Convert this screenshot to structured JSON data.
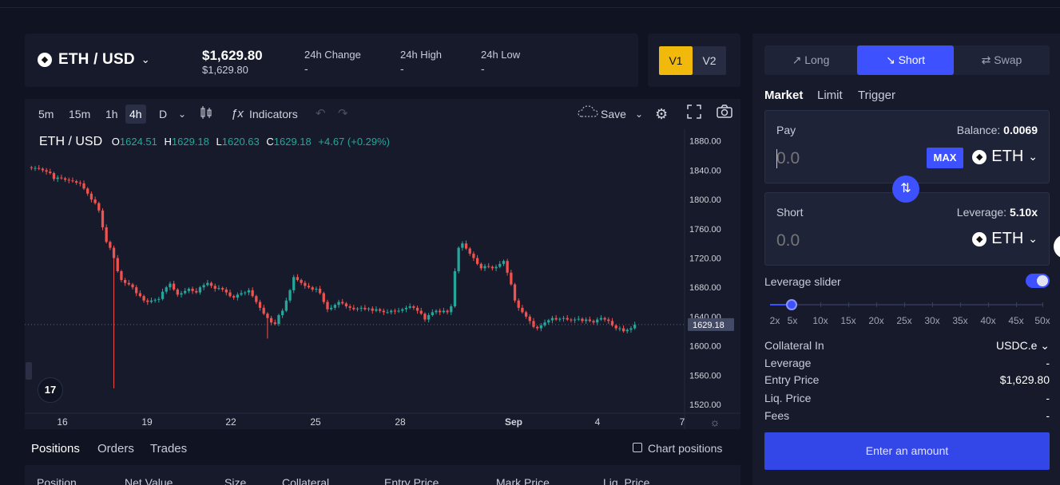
{
  "header": {
    "pair": "ETH / USD",
    "token_symbol": "◆",
    "price": "$1,629.80",
    "price_sub": "$1,629.80",
    "stats": [
      {
        "label": "24h Change",
        "value": "-"
      },
      {
        "label": "24h High",
        "value": "-"
      },
      {
        "label": "24h Low",
        "value": "-"
      }
    ],
    "versions": [
      "V1",
      "V2"
    ]
  },
  "toolbar": {
    "intervals": [
      "5m",
      "15m",
      "1h",
      "4h",
      "D"
    ],
    "active_interval": "4h",
    "indicators_label": "Indicators",
    "save_label": "Save"
  },
  "legend": {
    "symbol": "ETH / USD",
    "o_label": "O",
    "o": "1624.51",
    "h_label": "H",
    "h": "1629.18",
    "l_label": "L",
    "l": "1620.63",
    "c_label": "C",
    "c": "1629.18",
    "change": "+4.67 (+0.29%)"
  },
  "chart_data": {
    "type": "candlestick",
    "x_tick_labels": [
      "16",
      "19",
      "22",
      "25",
      "28",
      "Sep",
      "4",
      "7"
    ],
    "y_tick_labels": [
      "1880.00",
      "1840.00",
      "1800.00",
      "1760.00",
      "1720.00",
      "1680.00",
      "1640.00",
      "1600.00",
      "1560.00",
      "1520.00"
    ],
    "ylim": [
      1508,
      1896
    ],
    "last_price_label": "1629.18",
    "last_price": 1629.18,
    "colors": {
      "up": "#26a69a",
      "down": "#ef5350"
    },
    "close_series": [
      1843,
      1843,
      1842,
      1840,
      1838,
      1836,
      1828,
      1830,
      1829,
      1827,
      1826,
      1825,
      1823,
      1822,
      1815,
      1808,
      1800,
      1795,
      1785,
      1762,
      1742,
      1734,
      1720,
      1702,
      1690,
      1686,
      1684,
      1680,
      1672,
      1668,
      1662,
      1660,
      1662,
      1663,
      1664,
      1674,
      1680,
      1685,
      1677,
      1670,
      1672,
      1675,
      1678,
      1675,
      1673,
      1680,
      1683,
      1686,
      1682,
      1678,
      1679,
      1677,
      1673,
      1668,
      1666,
      1670,
      1672,
      1673,
      1676,
      1668,
      1660,
      1652,
      1644,
      1638,
      1632,
      1630,
      1642,
      1648,
      1662,
      1676,
      1694,
      1690,
      1686,
      1682,
      1680,
      1677,
      1678,
      1672,
      1660,
      1650,
      1652,
      1656,
      1660,
      1658,
      1654,
      1652,
      1650,
      1651,
      1652,
      1650,
      1651,
      1648,
      1650,
      1648,
      1646,
      1646,
      1648,
      1647,
      1648,
      1650,
      1652,
      1654,
      1652,
      1648,
      1644,
      1636,
      1642,
      1646,
      1648,
      1646,
      1648,
      1646,
      1654,
      1702,
      1734,
      1740,
      1733,
      1726,
      1720,
      1712,
      1706,
      1709,
      1708,
      1706,
      1708,
      1712,
      1716,
      1700,
      1684,
      1662,
      1652,
      1646,
      1640,
      1634,
      1626,
      1624,
      1628,
      1632,
      1635,
      1638,
      1636,
      1637,
      1638,
      1636,
      1635,
      1636,
      1637,
      1634,
      1636,
      1634,
      1632,
      1636,
      1638,
      1636,
      1634,
      1628,
      1624,
      1624,
      1620,
      1622,
      1624,
      1629
    ]
  },
  "bottom": {
    "tabs": [
      "Positions",
      "Orders",
      "Trades"
    ],
    "chart_positions_label": "Chart positions",
    "columns": [
      "Position",
      "Net Value",
      "Size",
      "Collateral",
      "Entry Price",
      "Mark Price",
      "Liq. Price"
    ]
  },
  "panel": {
    "modes": [
      "Long",
      "Short",
      "Swap"
    ],
    "active_mode": "Short",
    "order_types": [
      "Market",
      "Limit",
      "Trigger"
    ],
    "pay": {
      "label": "Pay",
      "balance_label": "Balance:",
      "balance": "0.0069",
      "placeholder": "0.0",
      "max_label": "MAX",
      "token": "ETH"
    },
    "short": {
      "label": "Short",
      "leverage_label": "Leverage:",
      "leverage": "5.10x",
      "placeholder": "0.0",
      "token": "ETH"
    },
    "leverage_slider_label": "Leverage slider",
    "leverage_slider_enabled": true,
    "leverage_marks": [
      "2x",
      "5x",
      "10x",
      "15x",
      "20x",
      "25x",
      "30x",
      "35x",
      "40x",
      "45x",
      "50x"
    ],
    "leverage_value": 5.1,
    "info": [
      {
        "label": "Collateral In",
        "value": "USDC.e ⌄"
      },
      {
        "label": "Leverage",
        "value": "-"
      },
      {
        "label": "Entry Price",
        "value": "$1,629.80"
      },
      {
        "label": "Liq. Price",
        "value": "-"
      },
      {
        "label": "Fees",
        "value": "-"
      }
    ],
    "cta": "Enter an amount"
  }
}
